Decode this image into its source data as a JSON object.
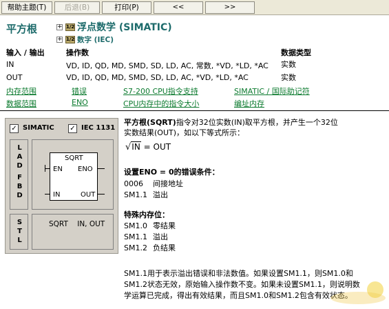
{
  "toolbar": {
    "help": "帮助主题(T)",
    "back": "后退(B)",
    "print": "打印(P)",
    "prev": "<<",
    "next": ">>"
  },
  "header": {
    "title": "平方根",
    "tree_main": "浮点数学 (SIMATIC)",
    "tree_sub": "数字 (IEC)",
    "tree_main_icon": "1/2",
    "tree_sub_icon": "1/2"
  },
  "io_table": {
    "headers": [
      "输入 / 输出",
      "操作数",
      "数据类型"
    ],
    "rows": [
      [
        "IN",
        "VD, ID, QD, MD, SMD, SD, LD, AC, 常数, *VD, *LD, *AC",
        "实数"
      ],
      [
        "OUT",
        "VD, ID, QD, MD, SMD, SD, LD, AC, *VD, *LD, *AC",
        "实数"
      ]
    ]
  },
  "links": [
    "内存范围",
    "错误",
    "S7-200 CPU指令支持",
    "SIMATIC / 国际助记符",
    "数据范围",
    "ENO",
    "CPU内存中的指令大小",
    "编址内存"
  ],
  "panel": {
    "simatic": "SIMATIC",
    "iec": "IEC 1131",
    "check": "✓",
    "side_top": [
      "L",
      "A",
      "D",
      "",
      "F",
      "B",
      "D"
    ],
    "side_bottom": [
      "S",
      "T",
      "L"
    ],
    "block_name": "SQRT",
    "en": "EN",
    "eno": "ENO",
    "in": "IN",
    "out": "OUT",
    "stl": "SQRT    IN, OUT"
  },
  "description": {
    "line1_pre": "平方根(SQRT)",
    "line1_post": "指令对32位实数(IN)取平方根，并产生一个32位",
    "line2": "实数结果(OUT)，如以下等式所示：",
    "formula_in": "IN",
    "formula_rest": " = OUT"
  },
  "errors": {
    "heading": "设置ENO = 0的错误条件：",
    "items": [
      {
        "code": "0006",
        "text": "间接地址"
      },
      {
        "code": "SM1.1",
        "text": "溢出"
      }
    ]
  },
  "memory_bits": {
    "heading": "特殊内存位：",
    "items": [
      {
        "code": "SM1.0",
        "text": "零结果"
      },
      {
        "code": "SM1.1",
        "text": "溢出"
      },
      {
        "code": "SM1.2",
        "text": "负结果"
      }
    ]
  },
  "note": {
    "line1": "SM1.1用于表示溢出错误和非法数值。如果设置SM1.1，则SM1.0和",
    "line2": "SM1.2状态无效，原始输入操作数不变。如果未设置SM1.1，则说明数",
    "line3": "学运算已完成，得出有效结果，而且SM1.0和SM1.2包含有效状态。"
  }
}
